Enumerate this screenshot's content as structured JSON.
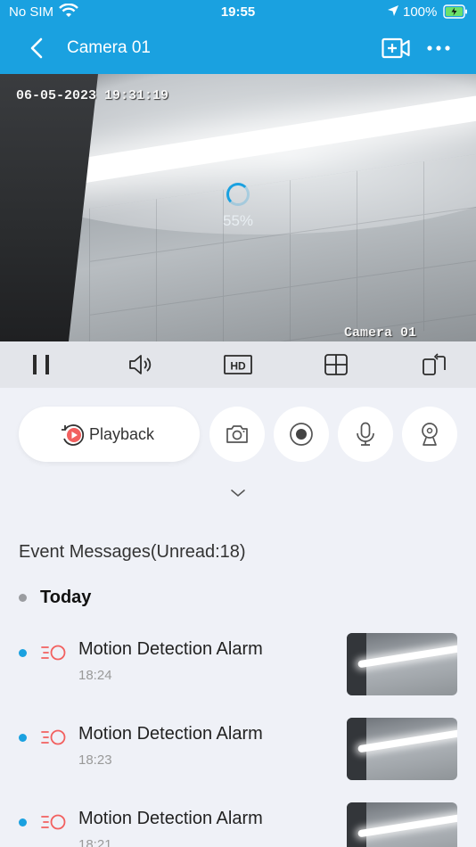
{
  "status_bar": {
    "carrier": "No SIM",
    "time": "19:55",
    "battery": "100%",
    "wifi_icon": "wifi-icon",
    "location_icon": "location-arrow-icon",
    "battery_icon": "battery-charging-icon"
  },
  "nav": {
    "title": "Camera 01",
    "back_icon": "chevron-left-icon",
    "add_icon": "add-camera-icon",
    "more_icon": "more-dots-icon"
  },
  "video": {
    "timestamp": "06-05-2023 19:31:19",
    "camera_label": "Camera 01",
    "loading_percent": "55%"
  },
  "controls": [
    "pause-icon",
    "volume-icon",
    "hd-icon",
    "split-screen-icon",
    "rotate-screen-icon"
  ],
  "actions": {
    "playback_label": "Playback",
    "buttons": [
      "camera-snapshot-icon",
      "record-icon",
      "microphone-icon",
      "ptz-icon"
    ]
  },
  "events": {
    "header": "Event Messages(Unread:18)",
    "group": "Today",
    "items": [
      {
        "title": "Motion Detection Alarm",
        "time": "18:24"
      },
      {
        "title": "Motion Detection Alarm",
        "time": "18:23"
      },
      {
        "title": "Motion Detection Alarm",
        "time": "18:21"
      }
    ]
  },
  "colors": {
    "accent": "#1aa1e0",
    "alarm": "#f2605f",
    "background": "#eff1f7"
  }
}
